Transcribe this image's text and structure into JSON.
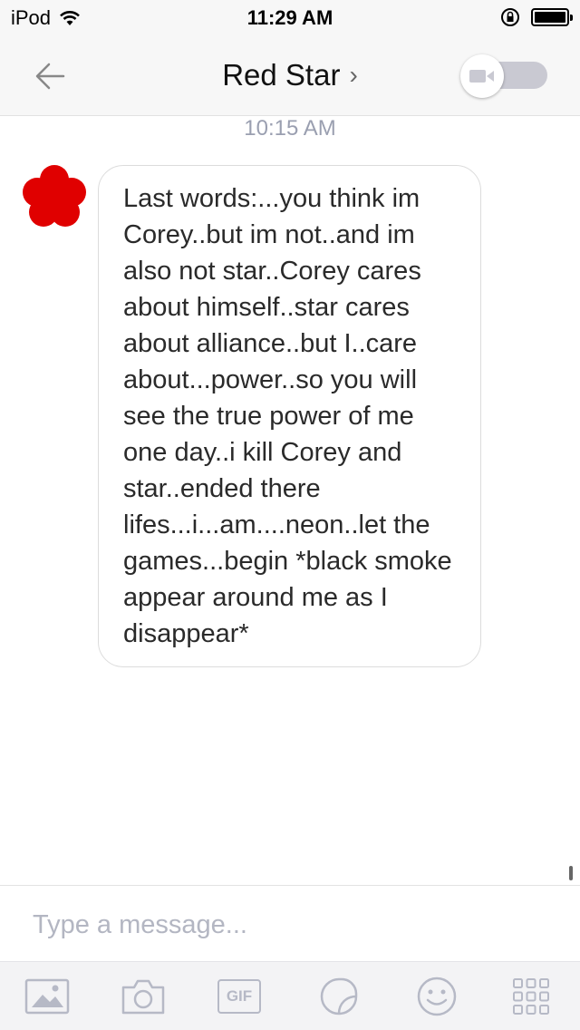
{
  "status_bar": {
    "device": "iPod",
    "time": "11:29 AM",
    "icons": [
      "wifi-icon",
      "rotation-lock-icon",
      "battery-icon"
    ]
  },
  "nav": {
    "back_icon": "back-arrow-icon",
    "title": "Red Star",
    "title_chevron": "›",
    "video_icon": "video-camera-icon"
  },
  "conversation": {
    "timestamp": "10:15 AM",
    "messages": [
      {
        "sender_avatar": "red-flower-avatar",
        "text": "Last words:...you think im Corey..but im not..and im also not star..Corey cares about himself..star cares about alliance..but I..care about...power..so you will see the true power of me one day..i kill Corey and star..ended there lifes...i...am....neon..let the games...begin *black smoke appear around me as I disappear*"
      }
    ]
  },
  "composer": {
    "placeholder": "Type a message...",
    "value": ""
  },
  "toolbar": {
    "items": [
      "image-icon",
      "camera-icon",
      "gif-icon",
      "sticker-icon",
      "emoji-icon",
      "more-grid-icon"
    ],
    "gif_label": "GIF"
  },
  "colors": {
    "accent_gray": "#b6b9c6",
    "timestamp": "#9a9fb0",
    "avatar_red": "#e00000",
    "toggle_track": "#c9c9d2"
  }
}
